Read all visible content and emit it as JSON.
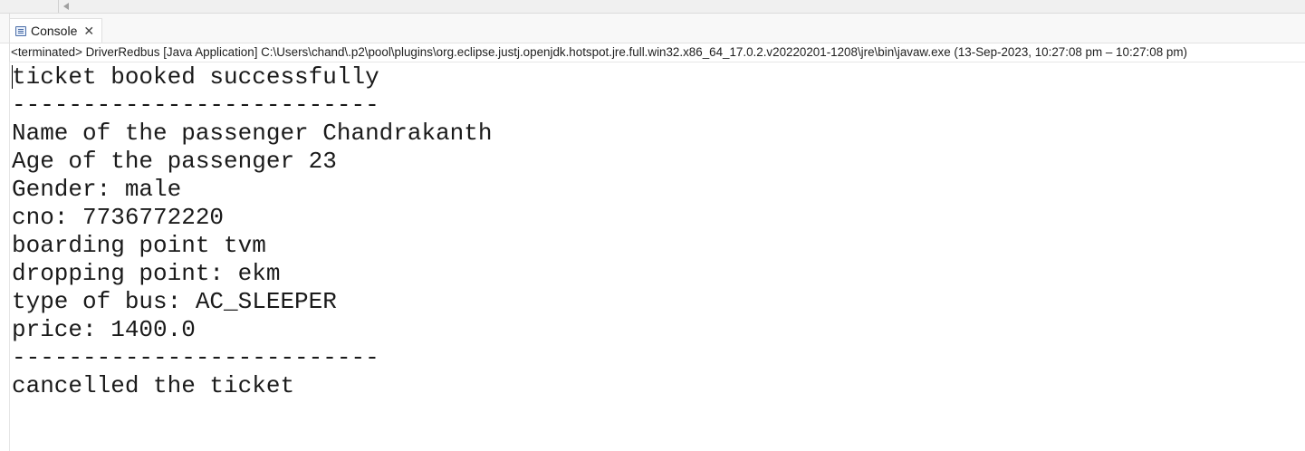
{
  "console_tab": {
    "label": "Console",
    "close_glyph": "✕",
    "icon": "console-icon"
  },
  "status": {
    "text": "<terminated> DriverRedbus [Java Application] C:\\Users\\chand\\.p2\\pool\\plugins\\org.eclipse.justj.openjdk.hotspot.jre.full.win32.x86_64_17.0.2.v20220201-1208\\jre\\bin\\javaw.exe  (13-Sep-2023, 10:27:08 pm – 10:27:08 pm)"
  },
  "output": {
    "lines": [
      "ticket booked successfully",
      "--------------------------",
      "Name of the passenger Chandrakanth",
      "Age of the passenger 23",
      "Gender: male",
      "cno: 7736772220",
      "boarding point tvm",
      "dropping point: ekm",
      "type of bus: AC_SLEEPER",
      "price: 1400.0",
      "--------------------------",
      "cancelled the ticket"
    ]
  }
}
